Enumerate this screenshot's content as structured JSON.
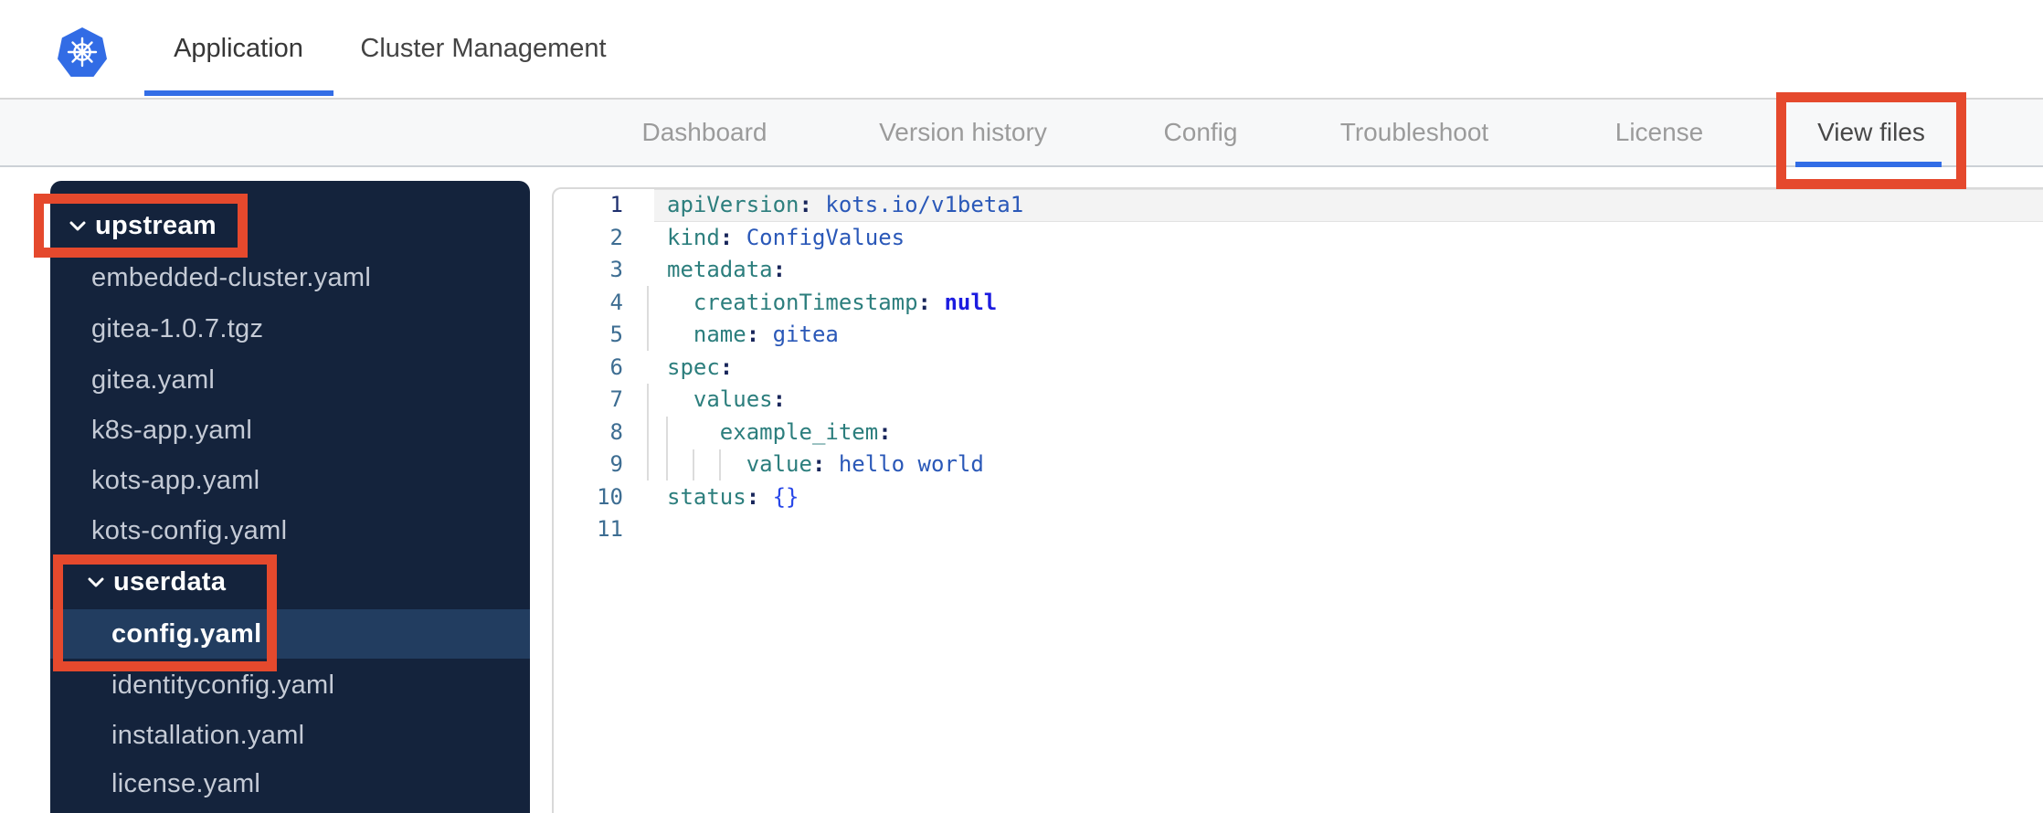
{
  "header": {
    "tabs": [
      {
        "label": "Application",
        "active": true
      },
      {
        "label": "Cluster Management",
        "active": false
      }
    ]
  },
  "subnav": {
    "items": [
      {
        "label": "Dashboard",
        "active": false
      },
      {
        "label": "Version history",
        "active": false
      },
      {
        "label": "Config",
        "active": false
      },
      {
        "label": "Troubleshoot",
        "active": false
      },
      {
        "label": "License",
        "active": false
      },
      {
        "label": "View files",
        "active": true
      }
    ]
  },
  "file_tree": {
    "items": [
      {
        "type": "folder",
        "label": "upstream",
        "depth": 0,
        "expanded": true,
        "selected": false
      },
      {
        "type": "file",
        "label": "embedded-cluster.yaml",
        "depth": 1,
        "selected": false
      },
      {
        "type": "file",
        "label": "gitea-1.0.7.tgz",
        "depth": 1,
        "selected": false
      },
      {
        "type": "file",
        "label": "gitea.yaml",
        "depth": 1,
        "selected": false
      },
      {
        "type": "file",
        "label": "k8s-app.yaml",
        "depth": 1,
        "selected": false
      },
      {
        "type": "file",
        "label": "kots-app.yaml",
        "depth": 1,
        "selected": false
      },
      {
        "type": "file",
        "label": "kots-config.yaml",
        "depth": 1,
        "selected": false
      },
      {
        "type": "folder",
        "label": "userdata",
        "depth": 1,
        "expanded": true,
        "selected": false
      },
      {
        "type": "file",
        "label": "config.yaml",
        "depth": 2,
        "selected": true
      },
      {
        "type": "file",
        "label": "identityconfig.yaml",
        "depth": 2,
        "selected": false
      },
      {
        "type": "file",
        "label": "installation.yaml",
        "depth": 2,
        "selected": false
      },
      {
        "type": "file",
        "label": "license.yaml",
        "depth": 2,
        "selected": false
      }
    ]
  },
  "editor": {
    "language": "yaml",
    "current_line": 1,
    "lines": [
      {
        "n": 1,
        "tokens": [
          [
            "key",
            "apiVersion"
          ],
          [
            "punc",
            ": "
          ],
          [
            "str",
            "kots.io/v1beta1"
          ]
        ]
      },
      {
        "n": 2,
        "tokens": [
          [
            "key",
            "kind"
          ],
          [
            "punc",
            ": "
          ],
          [
            "str",
            "ConfigValues"
          ]
        ]
      },
      {
        "n": 3,
        "tokens": [
          [
            "key",
            "metadata"
          ],
          [
            "punc",
            ":"
          ]
        ]
      },
      {
        "n": 4,
        "tokens": [
          [
            "plain",
            "  "
          ],
          [
            "key",
            "creationTimestamp"
          ],
          [
            "punc",
            ": "
          ],
          [
            "kw",
            "null"
          ]
        ]
      },
      {
        "n": 5,
        "tokens": [
          [
            "plain",
            "  "
          ],
          [
            "key",
            "name"
          ],
          [
            "punc",
            ": "
          ],
          [
            "str",
            "gitea"
          ]
        ]
      },
      {
        "n": 6,
        "tokens": [
          [
            "key",
            "spec"
          ],
          [
            "punc",
            ":"
          ]
        ]
      },
      {
        "n": 7,
        "tokens": [
          [
            "plain",
            "  "
          ],
          [
            "key",
            "values"
          ],
          [
            "punc",
            ":"
          ]
        ]
      },
      {
        "n": 8,
        "tokens": [
          [
            "plain",
            "    "
          ],
          [
            "key",
            "example_item"
          ],
          [
            "punc",
            ":"
          ]
        ]
      },
      {
        "n": 9,
        "tokens": [
          [
            "plain",
            "      "
          ],
          [
            "key",
            "value"
          ],
          [
            "punc",
            ": "
          ],
          [
            "str",
            "hello world"
          ]
        ]
      },
      {
        "n": 10,
        "tokens": [
          [
            "key",
            "status"
          ],
          [
            "punc",
            ": "
          ],
          [
            "brace",
            "{}"
          ]
        ]
      },
      {
        "n": 11,
        "tokens": []
      }
    ]
  },
  "annotations": {
    "color": "#e5492d",
    "targets": [
      "view-files-tab",
      "upstream-folder",
      "userdata-and-config-yaml"
    ]
  },
  "colors": {
    "accent_blue": "#326de6",
    "annotation_red": "#e5492d",
    "sidebar_bg": "#14233c",
    "sidebar_selected_bg": "#223d60",
    "logo_blue": "#326ce5",
    "code_key": "#2c7e7d",
    "code_value": "#2a58b8",
    "code_keyword": "#1c1ce0",
    "code_line_number": "#3d6d92"
  },
  "icons": {
    "logo": "kubernetes-helm-wheel",
    "tree_folder": "chevron-down"
  }
}
